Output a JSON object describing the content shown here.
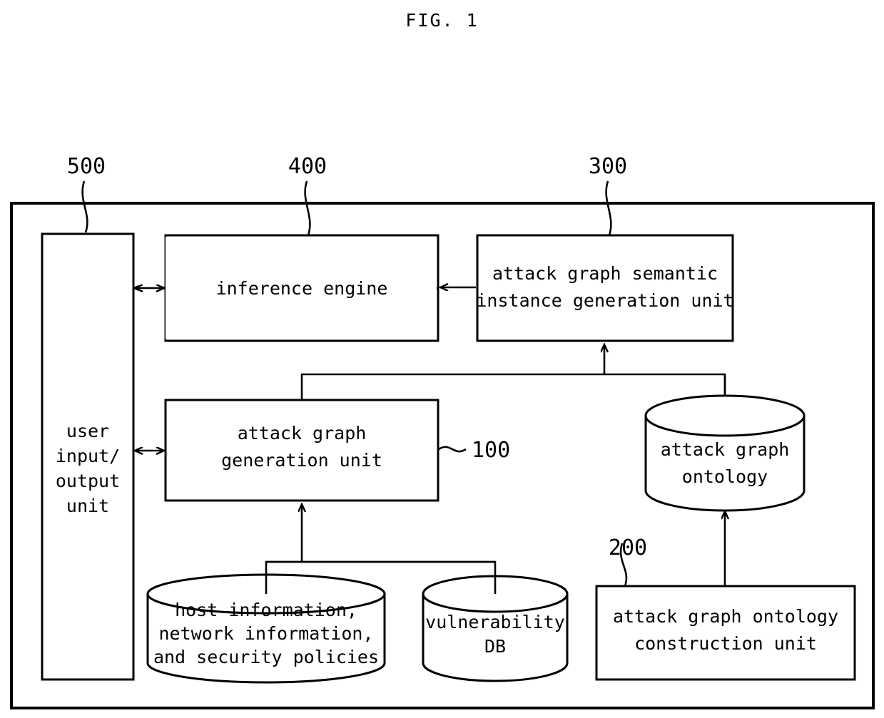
{
  "figure": {
    "title": "FIG. 1"
  },
  "reference_numerals": {
    "user_io": "500",
    "inference_engine": "400",
    "semantic_instance": "300",
    "generation_unit": "100",
    "ontology_construction": "200"
  },
  "blocks": {
    "user_io": {
      "lines": [
        "user",
        "input/",
        "output",
        "unit"
      ]
    },
    "inference_engine": {
      "lines": [
        "inference engine"
      ]
    },
    "semantic_instance": {
      "lines": [
        "attack graph semantic",
        "instance generation unit"
      ]
    },
    "generation_unit": {
      "lines": [
        "attack graph",
        "generation unit"
      ]
    },
    "ontology_store": {
      "lines": [
        "attack graph",
        "ontology"
      ]
    },
    "host_db": {
      "lines": [
        "host information,",
        "network information,",
        "and security policies"
      ]
    },
    "vulnerability_db": {
      "lines": [
        "vulnerability",
        "DB"
      ]
    },
    "ontology_construction": {
      "lines": [
        "attack graph ontology",
        "construction unit"
      ]
    }
  },
  "colors": {
    "stroke": "#000000",
    "background": "#ffffff"
  }
}
